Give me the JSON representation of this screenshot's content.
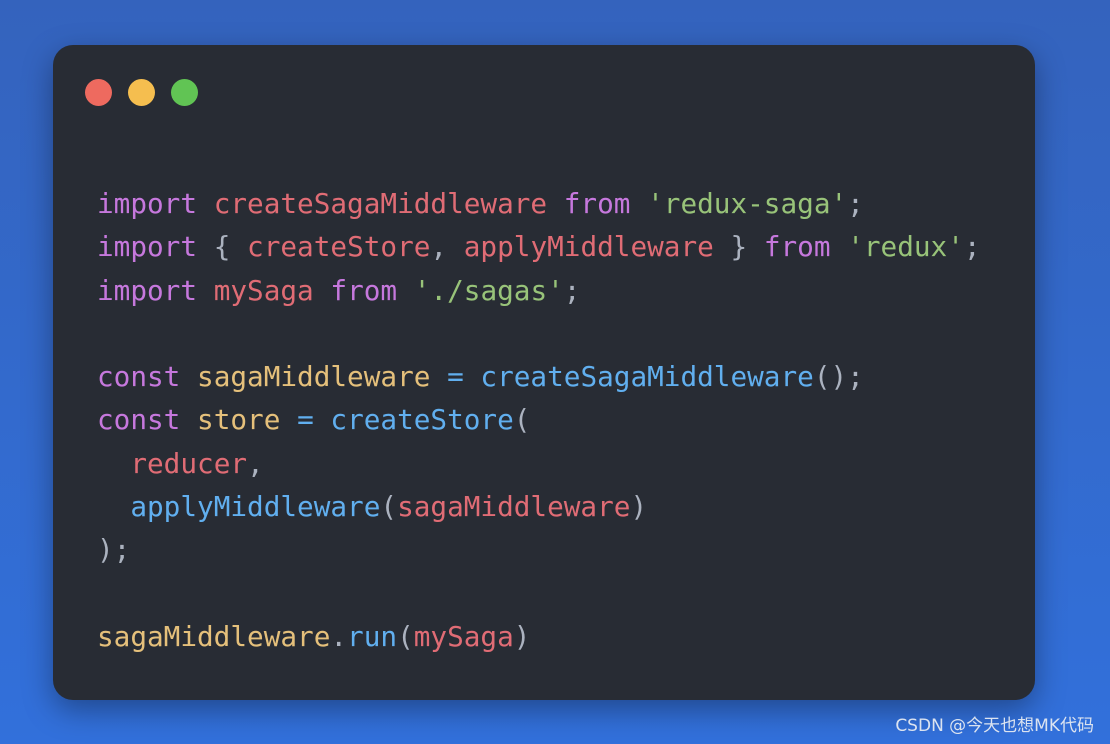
{
  "window": {
    "controls": [
      {
        "name": "close",
        "color": "#ee6a5f"
      },
      {
        "name": "minimize",
        "color": "#f5be4f"
      },
      {
        "name": "maximize",
        "color": "#61c454"
      }
    ]
  },
  "colors": {
    "keyword": "#c678dd",
    "variable": "#e06c75",
    "string": "#98c379",
    "function": "#61afef",
    "constant": "#e5c07b",
    "punct": "#abb2bf"
  },
  "code": {
    "lines": [
      [
        [
          "keyword",
          "import"
        ],
        [
          "punct",
          " "
        ],
        [
          "variable",
          "createSagaMiddleware"
        ],
        [
          "punct",
          " "
        ],
        [
          "keyword",
          "from"
        ],
        [
          "punct",
          " "
        ],
        [
          "string",
          "'redux-saga'"
        ],
        [
          "punct",
          ";"
        ]
      ],
      [
        [
          "keyword",
          "import"
        ],
        [
          "punct",
          " { "
        ],
        [
          "variable",
          "createStore"
        ],
        [
          "punct",
          ", "
        ],
        [
          "variable",
          "applyMiddleware"
        ],
        [
          "punct",
          " } "
        ],
        [
          "keyword",
          "from"
        ],
        [
          "punct",
          " "
        ],
        [
          "string",
          "'redux'"
        ],
        [
          "punct",
          ";"
        ]
      ],
      [
        [
          "keyword",
          "import"
        ],
        [
          "punct",
          " "
        ],
        [
          "variable",
          "mySaga"
        ],
        [
          "punct",
          " "
        ],
        [
          "keyword",
          "from"
        ],
        [
          "punct",
          " "
        ],
        [
          "string",
          "'./sagas'"
        ],
        [
          "punct",
          ";"
        ]
      ],
      [],
      [
        [
          "keyword",
          "const"
        ],
        [
          "punct",
          " "
        ],
        [
          "constant",
          "sagaMiddleware"
        ],
        [
          "punct",
          " "
        ],
        [
          "function",
          "="
        ],
        [
          "punct",
          " "
        ],
        [
          "function",
          "createSagaMiddleware"
        ],
        [
          "punct",
          "();"
        ]
      ],
      [
        [
          "keyword",
          "const"
        ],
        [
          "punct",
          " "
        ],
        [
          "constant",
          "store"
        ],
        [
          "punct",
          " "
        ],
        [
          "function",
          "="
        ],
        [
          "punct",
          " "
        ],
        [
          "function",
          "createStore"
        ],
        [
          "punct",
          "("
        ]
      ],
      [
        [
          "punct",
          "  "
        ],
        [
          "variable",
          "reducer"
        ],
        [
          "punct",
          ","
        ]
      ],
      [
        [
          "punct",
          "  "
        ],
        [
          "function",
          "applyMiddleware"
        ],
        [
          "punct",
          "("
        ],
        [
          "variable",
          "sagaMiddleware"
        ],
        [
          "punct",
          ")"
        ]
      ],
      [
        [
          "punct",
          ");"
        ]
      ],
      [],
      [
        [
          "constant",
          "sagaMiddleware"
        ],
        [
          "punct",
          "."
        ],
        [
          "function",
          "run"
        ],
        [
          "punct",
          "("
        ],
        [
          "variable",
          "mySaga"
        ],
        [
          "punct",
          ")"
        ]
      ]
    ]
  },
  "watermark": "CSDN @今天也想MK代码"
}
